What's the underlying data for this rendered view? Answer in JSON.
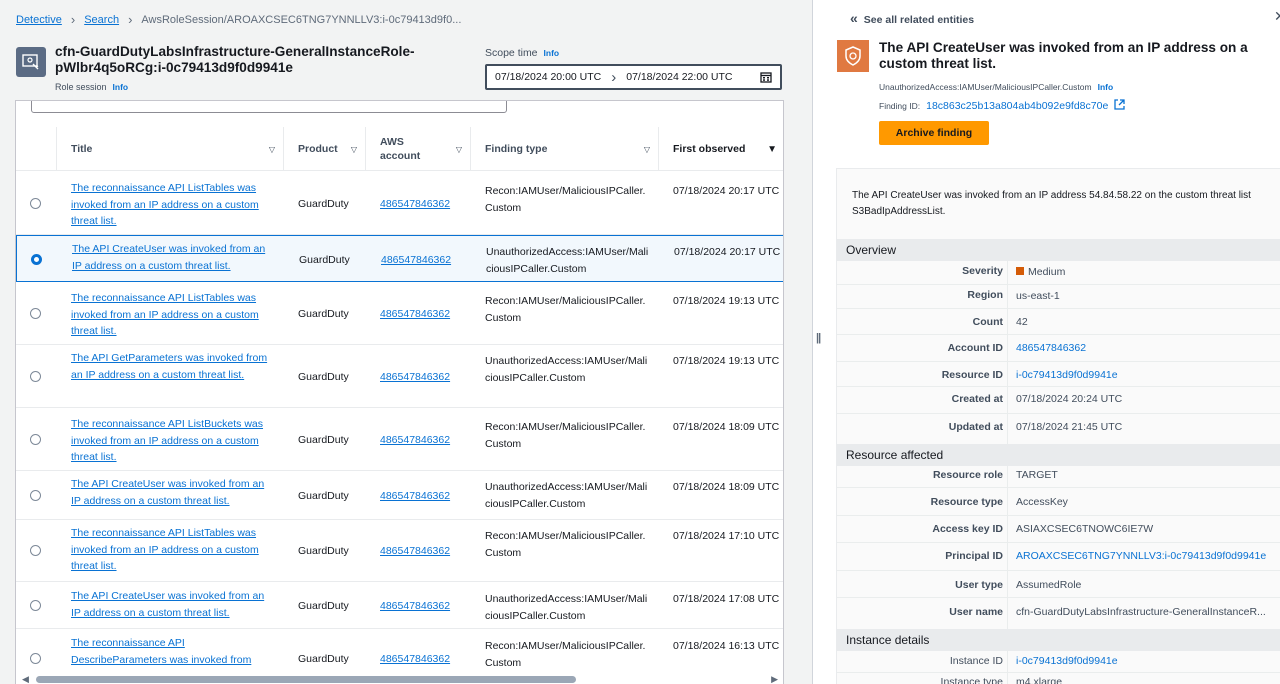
{
  "breadcrumb": {
    "detective": "Detective",
    "search": "Search",
    "current": "AwsRoleSession/AROAXCSEC6TNG7YNNLLV3:i-0c79413d9f0..."
  },
  "header": {
    "title": "cfn-GuardDutyLabsInfrastructure-GeneralInstanceRole-pWlbr4q5oRCg:i-0c79413d9f0d9941e",
    "subtitle": "Role session",
    "info": "Info",
    "scope_label": "Scope time",
    "scope_info": "Info",
    "scope_start": "07/18/2024 20:00 UTC",
    "scope_end": "07/18/2024 22:00 UTC"
  },
  "table": {
    "columns": {
      "title": "Title",
      "product": "Product",
      "account": "AWS account",
      "type": "Finding type",
      "first": "First observed"
    },
    "rows": [
      {
        "title": "The reconnaissance API ListTables was invoked from an IP address on a custom threat list.",
        "product": "GuardDuty",
        "account": "486547846362",
        "type": "Recon:IAMUser/MaliciousIPCaller.Custom",
        "first": "07/18/2024 20:17 UTC"
      },
      {
        "title": "The API CreateUser was invoked from an IP address on a custom threat list.",
        "product": "GuardDuty",
        "account": "486547846362",
        "type": "UnauthorizedAccess:IAMUser/MaliciousIPCaller.Custom",
        "first": "07/18/2024 20:17 UTC"
      },
      {
        "title": "The reconnaissance API ListTables was invoked from an IP address on a custom threat list.",
        "product": "GuardDuty",
        "account": "486547846362",
        "type": "Recon:IAMUser/MaliciousIPCaller.Custom",
        "first": "07/18/2024 19:13 UTC"
      },
      {
        "title": "The API GetParameters was invoked from an IP address on a custom threat list.",
        "product": "GuardDuty",
        "account": "486547846362",
        "type": "UnauthorizedAccess:IAMUser/MaliciousIPCaller.Custom",
        "first": "07/18/2024 19:13 UTC"
      },
      {
        "title": "The reconnaissance API ListBuckets was invoked from an IP address on a custom threat list.",
        "product": "GuardDuty",
        "account": "486547846362",
        "type": "Recon:IAMUser/MaliciousIPCaller.Custom",
        "first": "07/18/2024 18:09 UTC"
      },
      {
        "title": "The API CreateUser was invoked from an IP address on a custom threat list.",
        "product": "GuardDuty",
        "account": "486547846362",
        "type": "UnauthorizedAccess:IAMUser/MaliciousIPCaller.Custom",
        "first": "07/18/2024 18:09 UTC"
      },
      {
        "title": "The reconnaissance API ListTables was invoked from an IP address on a custom threat list.",
        "product": "GuardDuty",
        "account": "486547846362",
        "type": "Recon:IAMUser/MaliciousIPCaller.Custom",
        "first": "07/18/2024 17:10 UTC"
      },
      {
        "title": "The API CreateUser was invoked from an IP address on a custom threat list.",
        "product": "GuardDuty",
        "account": "486547846362",
        "type": "UnauthorizedAccess:IAMUser/MaliciousIPCaller.Custom",
        "first": "07/18/2024 17:08 UTC"
      },
      {
        "title": "The reconnaissance API DescribeParameters was invoked from",
        "product": "GuardDuty",
        "account": "486547846362",
        "type": "Recon:IAMUser/MaliciousIPCaller.Custom",
        "first": "07/18/2024 16:13 UTC"
      }
    ]
  },
  "panel": {
    "see_all": "See all related entities",
    "title": "The API CreateUser was invoked from an IP address on a custom threat list.",
    "finding_type": "UnauthorizedAccess:IAMUser/MaliciousIPCaller.Custom",
    "info": "Info",
    "finding_id_label": "Finding ID:",
    "finding_id": "18c863c25b13a804ab4b092e9fd8c70e",
    "archive": "Archive finding",
    "description": "The API CreateUser was invoked from an IP address 54.84.58.22 on the custom threat list S3BadIpAddressList.",
    "overview": {
      "heading": "Overview",
      "severity_k": "Severity",
      "severity_v": "Medium",
      "region_k": "Region",
      "region_v": "us-east-1",
      "count_k": "Count",
      "count_v": "42",
      "account_k": "Account ID",
      "account_v": "486547846362",
      "resource_k": "Resource ID",
      "resource_v": "i-0c79413d9f0d9941e",
      "created_k": "Created at",
      "created_v": "07/18/2024 20:24 UTC",
      "updated_k": "Updated at",
      "updated_v": "07/18/2024 21:45 UTC"
    },
    "resource": {
      "heading": "Resource affected",
      "role_k": "Resource role",
      "role_v": "TARGET",
      "type_k": "Resource type",
      "type_v": "AccessKey",
      "key_k": "Access key ID",
      "key_v": "ASIAXCSEC6TNOWC6IE7W",
      "principal_k": "Principal ID",
      "principal_v": "AROAXCSEC6TNG7YNNLLV3:i-0c79413d9f0d9941e",
      "usertype_k": "User type",
      "usertype_v": "AssumedRole",
      "username_k": "User name",
      "username_v": "cfn-GuardDutyLabsInfrastructure-GeneralInstanceR..."
    },
    "instance": {
      "heading": "Instance details",
      "id_k": "Instance ID",
      "id_v": "i-0c79413d9f0d9941e",
      "type_k": "Instance type",
      "type_v": "m4.xlarge"
    }
  }
}
